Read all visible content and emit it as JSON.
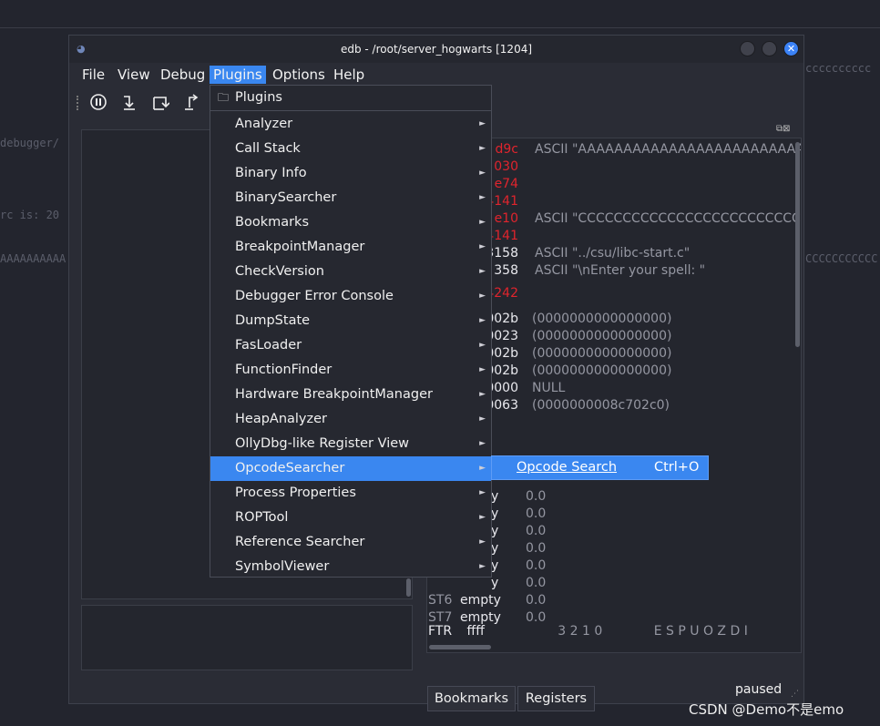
{
  "background": {
    "text_left_1": "debugger/",
    "text_left_2": "rc is: 20",
    "text_left_3": "AAAAAAAAAA",
    "text_right_1": "CCCCCCCCCCC",
    "text_right_top": "cccccccccc"
  },
  "window": {
    "title": "edb - /root/server_hogwarts [1204]",
    "logo": "edb-logo",
    "status": "paused"
  },
  "menubar": {
    "file": "File",
    "view": "View",
    "debug": "Debug",
    "plugins": "Plugins",
    "options": "Options",
    "help": "Help"
  },
  "toolbar": {
    "icons": [
      "pause-icon",
      "step-into-icon",
      "step-over-icon",
      "step-out-icon"
    ]
  },
  "plugins_menu": {
    "header": "Plugins",
    "items": [
      "Analyzer",
      "Call Stack",
      "Binary Info",
      "BinarySearcher",
      "Bookmarks",
      "BreakpointManager",
      "CheckVersion",
      "Debugger Error Console",
      "DumpState",
      "FasLoader",
      "FunctionFinder",
      "Hardware BreakpointManager",
      "HeapAnalyzer",
      "OllyDbg-like Register View",
      "OpcodeSearcher",
      "Process Properties",
      "ROPTool",
      "Reference Searcher",
      "SymbolViewer"
    ],
    "highlighted": "OpcodeSearcher"
  },
  "submenu": {
    "label": "Opcode Search",
    "shortcut": "Ctrl+O"
  },
  "registers": {
    "rows": [
      {
        "val": "d9c",
        "red": true,
        "comment": "ASCII \"AAAAAAAAAAAAAAAAAAAAAAAAA"
      },
      {
        "val": "030",
        "red": true,
        "comment": ""
      },
      {
        "val": "e74",
        "red": true,
        "comment": ""
      },
      {
        "val": "4141",
        "red": true,
        "comment": ""
      },
      {
        "val": "e10",
        "red": true,
        "comment": "ASCII \"CCCCCCCCCCCCCCCCCCCCCCCCC"
      },
      {
        "val": "4141",
        "red": true,
        "comment": ""
      },
      {
        "val": "3158",
        "red": false,
        "comment": "ASCII \"../csu/libc-start.c\""
      },
      {
        "val": "358",
        "red": false,
        "comment": "ASCII \"\\nEnter your spell: \""
      },
      {
        "val": "4242",
        "red": true,
        "comment": ""
      },
      {
        "val": "002b",
        "red": false,
        "comment": "(0000000000000000)"
      },
      {
        "val": "0023",
        "red": false,
        "comment": "(0000000000000000)"
      },
      {
        "val": "002b",
        "red": false,
        "comment": "(0000000000000000)"
      },
      {
        "val": "002b",
        "red": false,
        "comment": "(0000000000000000)"
      },
      {
        "val": "0000",
        "red": false,
        "comment": "NULL"
      },
      {
        "val": "0063",
        "red": false,
        "comment": "(0000000008c702c0)"
      }
    ],
    "fpu_rows": [
      {
        "name": "",
        "state": "y",
        "value": "0.0"
      },
      {
        "name": "",
        "state": "y",
        "value": "0.0"
      },
      {
        "name": "",
        "state": "y",
        "value": "0.0"
      },
      {
        "name": "",
        "state": "y",
        "value": "0.0"
      },
      {
        "name": "",
        "state": "y",
        "value": "0.0"
      },
      {
        "name": "",
        "state": "y",
        "value": "0.0"
      },
      {
        "name": "ST6",
        "state": "empty",
        "value": "0.0"
      },
      {
        "name": "ST7",
        "state": "empty",
        "value": "0.0"
      }
    ],
    "ftr_label": "FTR",
    "ftr_value": "ffff",
    "ftr_bits": "3 2 1 0",
    "ftr_flags": "E S P U O Z D I"
  },
  "tabs": {
    "bookmarks": "Bookmarks",
    "registers": "Registers"
  },
  "watermark": "CSDN @Demo不是emo"
}
